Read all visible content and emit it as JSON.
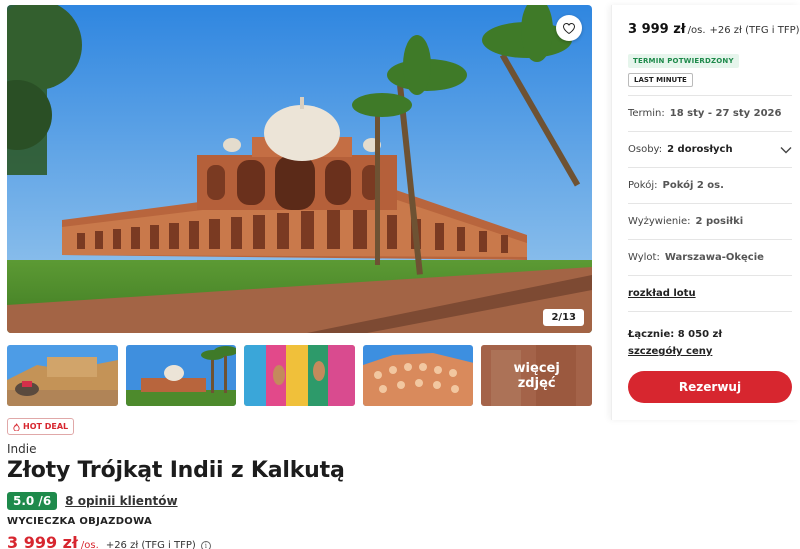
{
  "gallery": {
    "counter": "2/13",
    "more_label_1": "więcej",
    "more_label_2": "zdjęć",
    "colors": {
      "sky": "#3f93e0",
      "stone": "#c47a4e",
      "grass": "#4f8a2b"
    }
  },
  "offer": {
    "hot_badge": "HOT DEAL",
    "country": "Indie",
    "title": "Złoty Trójkąt Indii z Kalkutą",
    "rating": "5.0 /6",
    "reviews": "8 opinii klientów",
    "trip_type": "WYCIECZKA OBJAZDOWA",
    "price": "3 999 zł",
    "per_person": "/os.",
    "price_extra": "+26 zł (TFG i TFP)"
  },
  "panel": {
    "price": "3 999 zł",
    "per_person": "/os.",
    "price_extra": "+26 zł (TFG i TFP)",
    "tag_confirmed": "TERMIN POTWIERDZONY",
    "tag_last_minute": "LAST MINUTE",
    "termin_label": "Termin:",
    "termin_value": "18 sty - 27 sty 2026",
    "osoby_label": "Osoby:",
    "osoby_value": "2 dorosłych",
    "pokoj_label": "Pokój:",
    "pokoj_value": "Pokój 2 os.",
    "wyzywienie_label": "Wyżywienie:",
    "wyzywienie_value": "2 posiłki",
    "wylot_label": "Wylot:",
    "wylot_value": "Warszawa-Okęcie",
    "flight_link": "rozkład lotu",
    "total_label": "Łącznie:",
    "total_value": "8 050 zł",
    "price_details_link": "szczegóły ceny",
    "book_button": "Rezerwuj",
    "accent": "#d7262f"
  }
}
